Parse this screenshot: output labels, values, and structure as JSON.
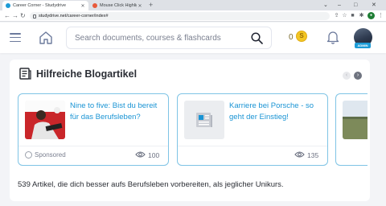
{
  "browser": {
    "tabs": [
      {
        "title": "Career Corner - Studydrive",
        "active": true,
        "favicon_color": "#1c9bd6"
      },
      {
        "title": "Mouse Click Highlighter mit b...",
        "active": false,
        "favicon_color": "#e8593a"
      }
    ],
    "new_tab": "+",
    "url": "studydrive.net/career-corner/index#",
    "window_controls": [
      "⌄",
      "–",
      "□",
      "✕"
    ]
  },
  "header": {
    "search_placeholder": "Search documents, courses & flashcards",
    "coins": "0",
    "coin_symbol": "S",
    "avatar_badge": "ADMIN"
  },
  "section": {
    "title": "Hilfreiche Blogartikel",
    "footer": "539 Artikel, die dich besser aufs Berufsleben vorbereiten, als jeglicher Unikurs."
  },
  "articles": [
    {
      "title": "Nine to five: Bist du bereit für das Berufsleben?",
      "sponsored": "Sponsored",
      "views": "100"
    },
    {
      "title": "Karriere bei Porsche - so geht der Einstieg!",
      "sponsored": "",
      "views": "135"
    }
  ],
  "colors": {
    "accent": "#1a94d4",
    "card_border": "#7fc4e5",
    "coin": "#f3c623"
  }
}
